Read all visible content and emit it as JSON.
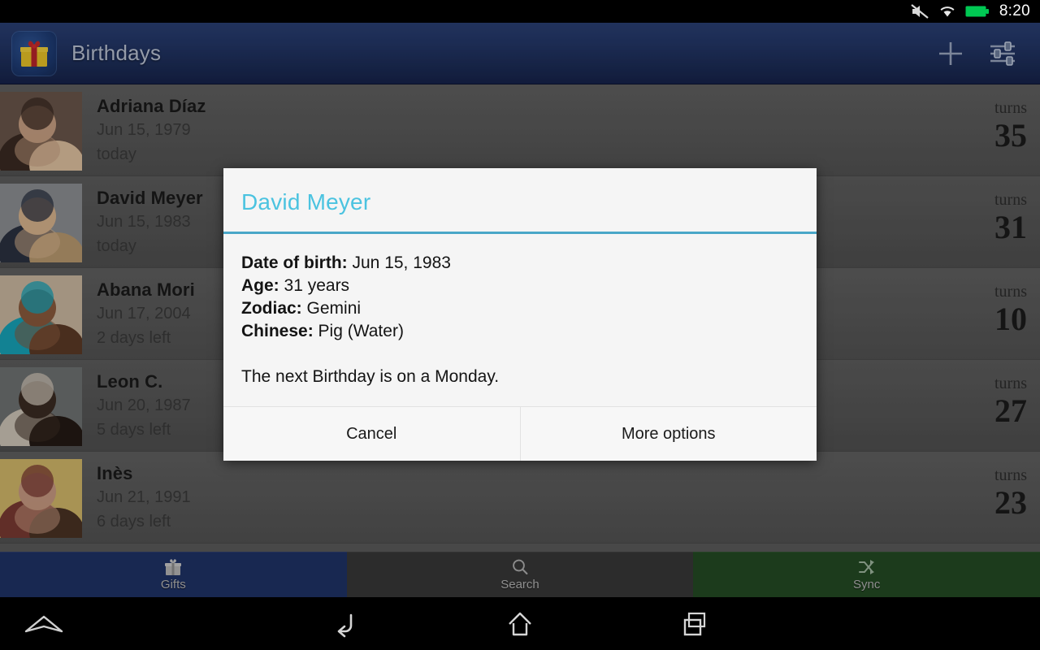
{
  "status_bar": {
    "time": "8:20",
    "icons": [
      "mute-icon",
      "wifi-icon",
      "battery-icon"
    ],
    "battery_color": "#00c853"
  },
  "action_bar": {
    "app_icon": "gift-box-icon",
    "title": "Birthdays",
    "actions": [
      {
        "name": "add-icon",
        "label": "+"
      },
      {
        "name": "settings-sliders-icon",
        "label": ""
      }
    ],
    "background_top": "#2a3f73",
    "background_bottom": "#16224a"
  },
  "list": {
    "turns_label": "turns",
    "rows": [
      {
        "name": "Adriana Díaz",
        "date": "Jun 15, 1979",
        "countdown": "today",
        "turns": "35",
        "photo": "couple-photo"
      },
      {
        "name": "David Meyer",
        "date": "Jun 15, 1983",
        "countdown": "today",
        "turns": "31",
        "photo": "man-blond-photo"
      },
      {
        "name": "Abana Mori",
        "date": "Jun 17, 2004",
        "countdown": "2 days left",
        "turns": "10",
        "photo": "girl-curly-photo"
      },
      {
        "name": "Leon C.",
        "date": "Jun 20, 1987",
        "countdown": "5 days left",
        "turns": "27",
        "photo": "man-smiling-photo"
      },
      {
        "name": "Inès",
        "date": "Jun 21, 1991",
        "countdown": "6 days left",
        "turns": "23",
        "photo": "woman-photo"
      }
    ]
  },
  "tabs": [
    {
      "label": "Gifts",
      "icon": "gift-icon",
      "color": "#1f3266",
      "selected": true
    },
    {
      "label": "Search",
      "icon": "search-icon",
      "color": "#373737",
      "selected": false
    },
    {
      "label": "Sync",
      "icon": "shuffle-icon",
      "color": "#244a24",
      "selected": false
    }
  ],
  "dialog": {
    "title": "David Meyer",
    "accent_color": "#4bc3e0",
    "rule_color": "#4aa7c8",
    "fields": [
      {
        "label": "Date of birth:",
        "value": "Jun 15, 1983"
      },
      {
        "label": "Age:",
        "value": "31 years"
      },
      {
        "label": "Zodiac:",
        "value": "Gemini"
      },
      {
        "label": "Chinese:",
        "value": "Pig (Water)"
      }
    ],
    "note": "The next Birthday is on a Monday.",
    "buttons": [
      {
        "label": "Cancel",
        "name": "cancel-button"
      },
      {
        "label": "More options",
        "name": "more-options-button"
      }
    ]
  },
  "navbar": {
    "buttons": [
      {
        "name": "collapse-chevron-icon"
      },
      {
        "name": "back-icon"
      },
      {
        "name": "home-icon"
      },
      {
        "name": "recents-icon"
      }
    ]
  }
}
